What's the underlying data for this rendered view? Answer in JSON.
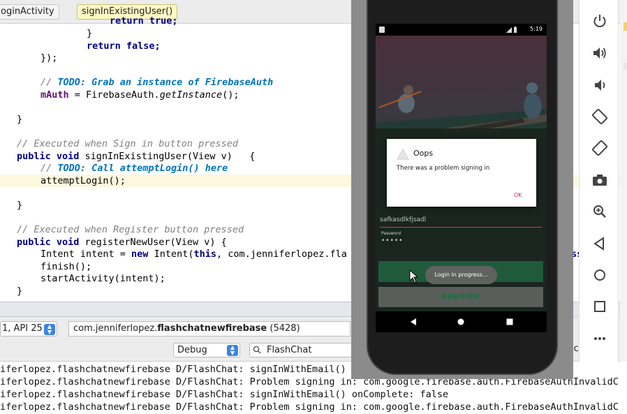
{
  "breadcrumbs": [
    "oginActivity",
    "signInExistingUser()"
  ],
  "editor": {
    "lines": {
      "l1": "return true;",
      "l2": "}",
      "l3": "return false;",
      "l4": "});",
      "l5_comment": "// ",
      "l5_todo": "TODO: Grab an instance of FirebaseAuth",
      "l6_field": "mAuth",
      "l6_rest_a": " = FirebaseAuth.",
      "l6_call": "getInstance",
      "l6_rest_b": "();",
      "l7": "}",
      "l8": "// Executed when Sign in button pressed",
      "l9_kw": "public void",
      "l9_rest": " signInExistingUser(View v)   {",
      "l10_comment": "// ",
      "l10_todo": "TODO: Call attemptLogin() here",
      "l11": "attemptLogin();",
      "l12": "}",
      "l13": "// Executed when Register button pressed",
      "l14_kw": "public void",
      "l14_rest": " registerNewUser(View v) {",
      "l15_a": "Intent intent = ",
      "l15_kw1": "new",
      "l15_b": " Intent(",
      "l15_kw2": "this",
      "l15_c": ", com.jenniferlopez.fla",
      "l15_tail": "ss",
      "l16": "finish();",
      "l17": "startActivity(intent);",
      "l18": "}"
    }
  },
  "device_selector": {
    "label": "1, API 25"
  },
  "process_selector": {
    "prefix": "com.jenniferlopez.",
    "bold": "flashchatnewfirebase",
    "pid": " (5428)"
  },
  "log_level": {
    "value": "Debug"
  },
  "log_search": {
    "value": "FlashChat"
  },
  "regex_fragment": "ic",
  "logcat": [
    "ifer­lopez.flashchatnewfirebase D/FlashChat: signInWithEmail()",
    "iferlopez.flashchatnewfirebase D/FlashChat: Problem signing in: com.google.firebase.auth.FirebaseAuthInvalidC",
    "iferlopez.flashchatnewfirebase D/FlashChat: signInWithEmail() onComplete: false",
    "iferlopez.flashchatnewfirebase D/FlashChat: Problem signing in: com.google.firebase.auth.FirebaseAuthInvalidC"
  ],
  "phone": {
    "time": "5:19",
    "email_value": "safkasdlkfjsadl",
    "password_label": "Password",
    "password_mask": "•••••",
    "toast": "Login in progress...",
    "register_label": "REGISTER",
    "dialog": {
      "title": "Oops",
      "message": "There was a problem signing in",
      "ok": "OK"
    }
  },
  "emulator_tools": [
    "power-icon",
    "volume-up-icon",
    "volume-down-icon",
    "rotate-left-icon",
    "rotate-right-icon",
    "camera-icon",
    "zoom-icon",
    "back-icon",
    "home-icon",
    "overview-icon",
    "more-icon"
  ],
  "colors": {
    "accent_blue": "#3b83e6",
    "todo_blue": "#0073bf",
    "keyword_navy": "#000080",
    "dialog_ok": "#d5294d",
    "register_green": "#1b6d3f"
  }
}
